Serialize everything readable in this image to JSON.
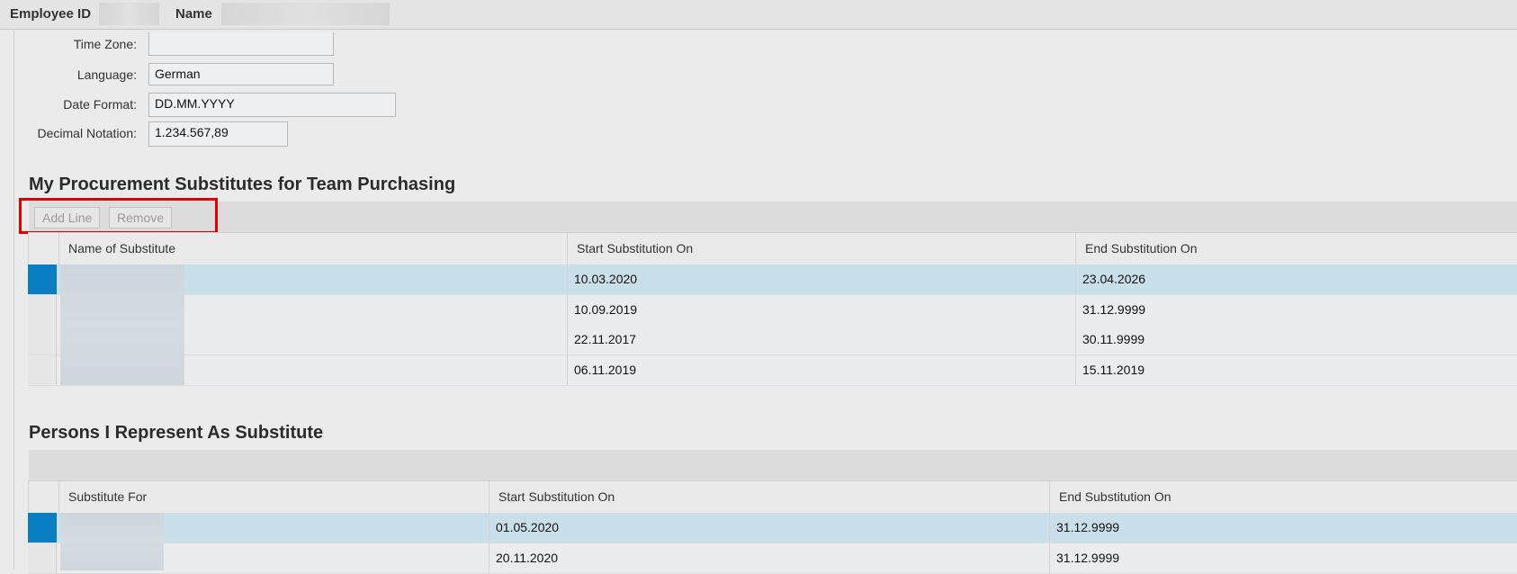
{
  "header": {
    "employee_id_label": "Employee ID",
    "name_label": "Name"
  },
  "form": {
    "time_zone": {
      "label": "Time Zone:",
      "value": ""
    },
    "language": {
      "label": "Language:",
      "value": "German"
    },
    "date_format": {
      "label": "Date Format:",
      "value": "DD.MM.YYYY"
    },
    "decimal_notation": {
      "label": "Decimal Notation:",
      "value": "1.234.567,89"
    }
  },
  "procurement": {
    "title": "My Procurement Substitutes for Team Purchasing",
    "toolbar": {
      "add_line": "Add Line",
      "remove": "Remove"
    },
    "columns": [
      "Name of Substitute",
      "Start Substitution On",
      "End Substitution On"
    ],
    "rows": [
      {
        "name": "",
        "start": "10.03.2020",
        "end": "23.04.2026",
        "selected": true
      },
      {
        "name": "",
        "start": "10.09.2019",
        "end": "31.12.9999",
        "selected": false
      },
      {
        "name": "",
        "start": "22.11.2017",
        "end": "30.11.9999",
        "selected": false
      },
      {
        "name": "",
        "start": "06.11.2019",
        "end": "15.11.2019",
        "selected": false
      }
    ]
  },
  "represent": {
    "title": "Persons I Represent As Substitute",
    "columns": [
      "Substitute For",
      "Start Substitution On",
      "End Substitution On"
    ],
    "rows": [
      {
        "name": "",
        "start": "01.05.2020",
        "end": "31.12.9999",
        "selected": true
      },
      {
        "name": "",
        "start": "20.11.2020",
        "end": "31.12.9999",
        "selected": false
      }
    ]
  },
  "colors": {
    "selection": "#0a7ec2",
    "selected_row": "#c9dfea",
    "highlight_box": "#e00000"
  }
}
